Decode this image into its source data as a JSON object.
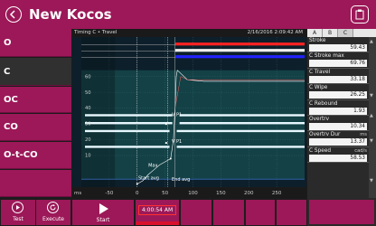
{
  "app": {
    "title": "New Kocos"
  },
  "operations": [
    {
      "label": "O",
      "selected": false
    },
    {
      "label": "C",
      "selected": true
    },
    {
      "label": "OC",
      "selected": false
    },
    {
      "label": "CO",
      "selected": false
    },
    {
      "label": "O-t-CO",
      "selected": false
    },
    {
      "label": "",
      "selected": false
    }
  ],
  "bottom_left": {
    "test_label": "Test",
    "execute_label": "Execute"
  },
  "chart_header": {
    "left": "Timing C • Travel",
    "right": "2/16/2016 2:09:42 AM"
  },
  "bottom_bar": {
    "start_label": "Start",
    "time": "4:00:54 AM"
  },
  "right_panel": {
    "header_date": "2/16/2016 2:09:42 AM",
    "tabs": [
      "A",
      "B",
      "C"
    ],
    "active_tab": "C",
    "items": [
      {
        "label": "Stroke",
        "unit": "",
        "value": "59.43"
      },
      {
        "label": "C Stroke max",
        "unit": "",
        "value": "69.76"
      },
      {
        "label": "C Travel",
        "unit": "",
        "value": "33.18"
      },
      {
        "label": "C Wipe",
        "unit": "",
        "value": "26.25"
      },
      {
        "label": "C Rebound",
        "unit": "",
        "value": "1.93"
      },
      {
        "label": "Overtrv",
        "unit": "",
        "value": "10.34"
      },
      {
        "label": "Overtrv Dur",
        "unit": "ms",
        "value": "13.37"
      },
      {
        "label": "C Speed",
        "unit": "cad/s",
        "value": "58.53"
      }
    ]
  },
  "chart_data": {
    "type": "line",
    "x_ticks": [
      -50,
      0,
      50,
      100,
      150,
      200,
      250
    ],
    "x_unit_label": "ms",
    "y_ticks": [
      10,
      20,
      30,
      40,
      50,
      60
    ],
    "xlim": [
      -100,
      300
    ],
    "ylim": [
      -10,
      85
    ],
    "annotations": [
      "V P1",
      "V P1",
      "Max",
      "Start avg",
      "End avg"
    ],
    "colors": {
      "background": "#0d1f2a",
      "green_zone": "#1a5c5c",
      "red_line": "#ff2222",
      "blue_line": "#2222ff",
      "travel_curve": "#ffffff",
      "bars": "#e8f8ff"
    }
  }
}
